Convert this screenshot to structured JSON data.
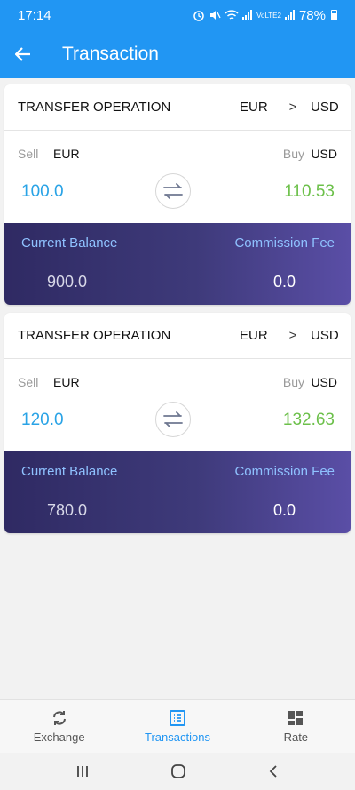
{
  "status": {
    "time": "17:14",
    "network": "VoLTE2",
    "battery": "78%"
  },
  "appbar": {
    "title": "Transaction"
  },
  "transactions": [
    {
      "operation": "TRANSFER OPERATION",
      "from": "EUR",
      "arrow": ">",
      "to": "USD",
      "sell_label": "Sell",
      "sell_currency": "EUR",
      "buy_label": "Buy",
      "buy_currency": "USD",
      "sell_amount": "100.0",
      "buy_amount": "110.53",
      "balance_label": "Current Balance",
      "balance_value": "900.0",
      "fee_label": "Commission Fee",
      "fee_value": "0.0"
    },
    {
      "operation": "TRANSFER OPERATION",
      "from": "EUR",
      "arrow": ">",
      "to": "USD",
      "sell_label": "Sell",
      "sell_currency": "EUR",
      "buy_label": "Buy",
      "buy_currency": "USD",
      "sell_amount": "120.0",
      "buy_amount": "132.63",
      "balance_label": "Current Balance",
      "balance_value": "780.0",
      "fee_label": "Commission Fee",
      "fee_value": "0.0"
    }
  ],
  "bottom_nav": [
    {
      "label": "Exchange",
      "icon": "refresh-icon",
      "active": false
    },
    {
      "label": "Transactions",
      "icon": "list-icon",
      "active": true
    },
    {
      "label": "Rate",
      "icon": "grid-icon",
      "active": false
    }
  ],
  "colors": {
    "primary": "#2196f3",
    "sell": "#29a3e6",
    "buy": "#6cc04a",
    "balance_bg": "#2f2a63"
  }
}
